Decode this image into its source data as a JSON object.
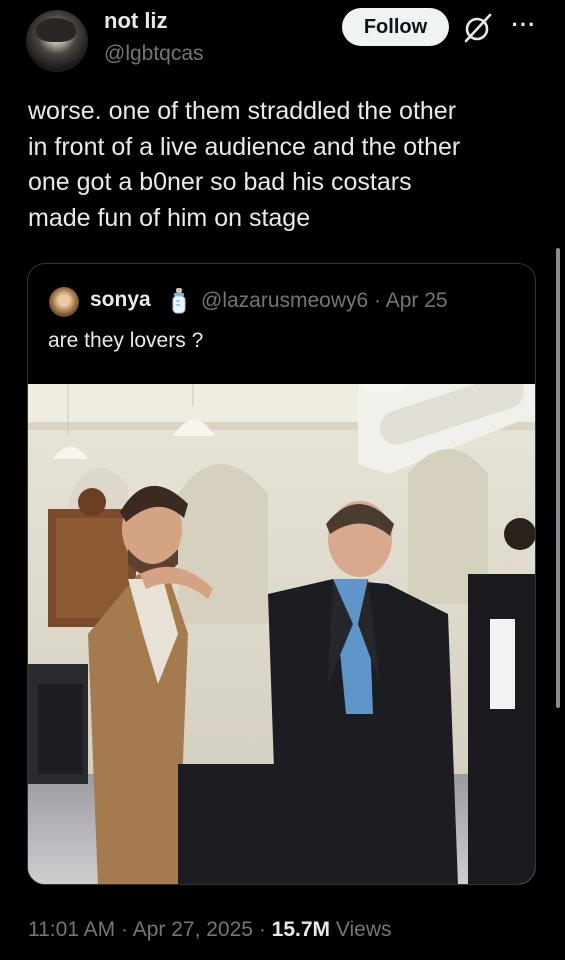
{
  "author": {
    "display_name": "not liz",
    "handle": "@lgbtqcas"
  },
  "header": {
    "follow_label": "Follow",
    "more_label": "···"
  },
  "tweet": {
    "text": "worse. one of them straddled the other\nin front of a live audience and the other\none got a b0ner so bad his costars\nmade fun of him on stage"
  },
  "quote": {
    "display_name": "sonya",
    "handle_and_date": "@lazarusmeowy6 · Apr 25",
    "text": "are they lovers ?"
  },
  "meta": {
    "time": "11:01 AM",
    "separator": "·",
    "date": "Apr 27, 2025",
    "views_count": "15.7M",
    "views_label": "Views"
  },
  "icons": {
    "grok": "grok-icon",
    "more": "more-icon",
    "badge": "baby-bottle-emoji-icon"
  },
  "colors": {
    "background": "#000000",
    "text_primary": "#e7e9ea",
    "text_secondary": "#71767b",
    "follow_button_bg": "#eff3f4",
    "border": "#333639"
  }
}
